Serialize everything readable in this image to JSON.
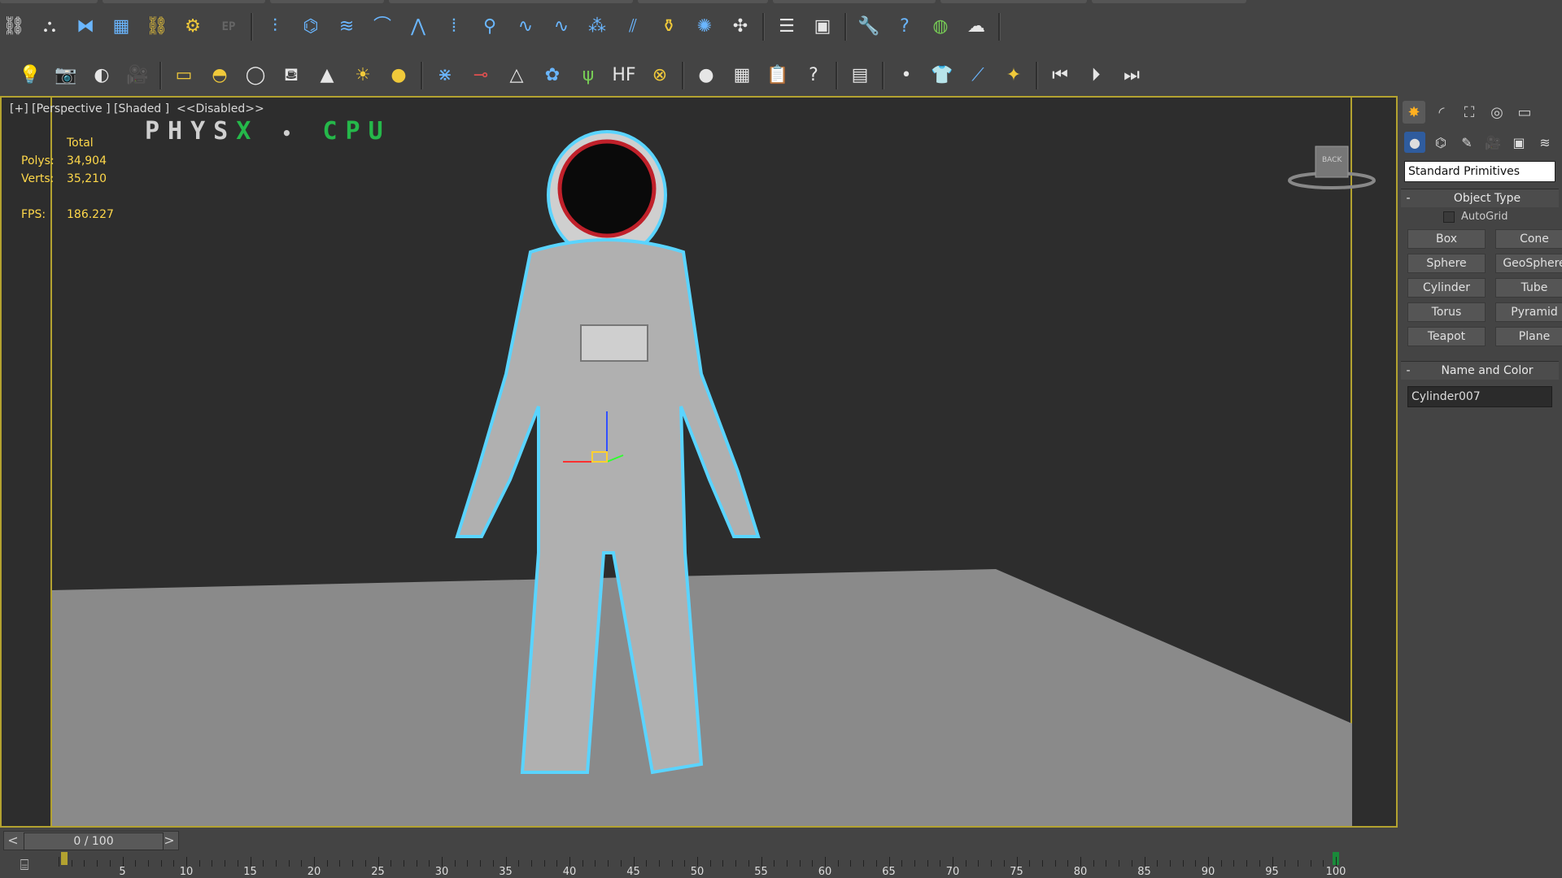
{
  "toolbar_top": {
    "icons": [
      {
        "name": "select-link-icon",
        "glyph": "⛓",
        "c": "w"
      },
      {
        "name": "unlink-icon",
        "glyph": "⛬",
        "c": "w"
      },
      {
        "name": "mirror-icon",
        "glyph": "⧓",
        "c": ""
      },
      {
        "name": "box-mesh-icon",
        "glyph": "▦",
        "c": ""
      },
      {
        "name": "link-tool-icon",
        "glyph": "⛓",
        "c": "y"
      },
      {
        "name": "gear-icon",
        "glyph": "⚙",
        "c": "y"
      },
      {
        "name": "ep-label-icon",
        "glyph": "EP",
        "c": "dim"
      },
      {
        "name": "hair-comb-icon",
        "glyph": "⫶",
        "c": ""
      },
      {
        "name": "hair-twist-icon",
        "glyph": "⌬",
        "c": ""
      },
      {
        "name": "hair-curl-icon",
        "glyph": "≋",
        "c": ""
      },
      {
        "name": "hair-arch-icon",
        "glyph": "⌒",
        "c": ""
      },
      {
        "name": "hair-spike-icon",
        "glyph": "⋀",
        "c": ""
      },
      {
        "name": "hair-strands-icon",
        "glyph": "⦙",
        "c": ""
      },
      {
        "name": "light-pin-icon",
        "glyph": "⚲",
        "c": ""
      },
      {
        "name": "hair-wave-icon",
        "glyph": "∿",
        "c": ""
      },
      {
        "name": "hair-wave2-icon",
        "glyph": "∿",
        "c": ""
      },
      {
        "name": "hair-clump-icon",
        "glyph": "⁂",
        "c": ""
      },
      {
        "name": "hair-brush-icon",
        "glyph": "⫽",
        "c": ""
      },
      {
        "name": "bottle-icon",
        "glyph": "⚱",
        "c": "y"
      },
      {
        "name": "emitter-icon",
        "glyph": "✺",
        "c": ""
      },
      {
        "name": "fan-icon",
        "glyph": "✣",
        "c": "w"
      },
      {
        "name": "script-icon",
        "glyph": "☰",
        "c": "w"
      },
      {
        "name": "render-setup-icon",
        "glyph": "▣",
        "c": "w"
      },
      {
        "name": "wrench-icon",
        "glyph": "🔧",
        "c": "r"
      },
      {
        "name": "help-icon",
        "glyph": "?",
        "c": ""
      },
      {
        "name": "globe-icon",
        "glyph": "◍",
        "c": "g"
      },
      {
        "name": "cloud-icon",
        "glyph": "☁",
        "c": "w"
      }
    ]
  },
  "toolbar_second": {
    "icons": [
      {
        "name": "lights-icon",
        "glyph": "💡",
        "c": "w"
      },
      {
        "name": "camera-icon",
        "glyph": "📷",
        "c": "w"
      },
      {
        "name": "sound-icon",
        "glyph": "◐",
        "c": "w"
      },
      {
        "name": "video-camera-icon",
        "glyph": "🎥",
        "c": "w"
      },
      {
        "name": "plane-object-icon",
        "glyph": "▭",
        "c": "y"
      },
      {
        "name": "dome-icon",
        "glyph": "◓",
        "c": "y"
      },
      {
        "name": "sphere-object-icon",
        "glyph": "◯",
        "c": "w"
      },
      {
        "name": "basket-icon",
        "glyph": "⛾",
        "c": "w"
      },
      {
        "name": "cone-object-icon",
        "glyph": "▲",
        "c": "w"
      },
      {
        "name": "sun-icon",
        "glyph": "☀",
        "c": "y"
      },
      {
        "name": "gold-sphere-icon",
        "glyph": "●",
        "c": "y"
      },
      {
        "name": "lattice-icon",
        "glyph": "⋇",
        "c": ""
      },
      {
        "name": "bones-icon",
        "glyph": "⊸",
        "c": "r"
      },
      {
        "name": "pyramid-wire-icon",
        "glyph": "△",
        "c": "w"
      },
      {
        "name": "geo-blob-icon",
        "glyph": "✿",
        "c": ""
      },
      {
        "name": "grass-icon",
        "glyph": "ψ",
        "c": "g"
      },
      {
        "name": "hf-icon",
        "glyph": "HF",
        "c": "w"
      },
      {
        "name": "ox-icon",
        "glyph": "⊗",
        "c": "y"
      },
      {
        "name": "shaded-sphere-icon",
        "glyph": "●",
        "c": "w"
      },
      {
        "name": "material-grid-icon",
        "glyph": "▦",
        "c": "w"
      },
      {
        "name": "clipboard-icon",
        "glyph": "📋",
        "c": "w"
      },
      {
        "name": "question-icon",
        "glyph": "?",
        "c": "w"
      },
      {
        "name": "render-frame-icon",
        "glyph": "▤",
        "c": "w"
      },
      {
        "name": "small-sphere-icon",
        "glyph": "•",
        "c": "w"
      },
      {
        "name": "tshirt-icon",
        "glyph": "👕",
        "c": "w"
      },
      {
        "name": "tube-tool-icon",
        "glyph": "⟋",
        "c": ""
      },
      {
        "name": "magic-wand-icon",
        "glyph": "✦",
        "c": "y"
      },
      {
        "name": "play-back-icon",
        "glyph": "⏮",
        "c": "w"
      },
      {
        "name": "play-icon",
        "glyph": "⏵",
        "c": "w"
      },
      {
        "name": "play-forward-icon",
        "glyph": "⏭",
        "c": "w"
      }
    ]
  },
  "viewport": {
    "label": "[+] [Perspective ] [Shaded ]  <<Disabled>>",
    "physx_left": "PHYS",
    "physx_x": "X",
    "physx_dot": "•",
    "physx_right": "CPU",
    "stats": {
      "header": "Total",
      "polys_label": "Polys:",
      "polys_value": "34,904",
      "verts_label": "Verts:",
      "verts_value": "35,210",
      "fps_label": "FPS:",
      "fps_value": "186.227"
    },
    "viewcube_label": "BACK",
    "colors": {
      "frame": "#b3a230",
      "background": "#2d2d2d",
      "ground": "#8a8a8a",
      "outline": "#5ad4ff"
    }
  },
  "command_panel": {
    "tabs": [
      {
        "name": "create-tab-icon",
        "glyph": "✸",
        "active": true
      },
      {
        "name": "modify-tab-icon",
        "glyph": "◜",
        "active": false
      },
      {
        "name": "hierarchy-tab-icon",
        "glyph": "⛶",
        "active": false
      },
      {
        "name": "motion-tab-icon",
        "glyph": "◎",
        "active": false
      },
      {
        "name": "display-tab-icon",
        "glyph": "▭",
        "active": false
      }
    ],
    "sub_tabs": [
      {
        "name": "geometry-subtab-icon",
        "glyph": "●",
        "active": true
      },
      {
        "name": "shapes-subtab-icon",
        "glyph": "⌬",
        "active": false
      },
      {
        "name": "lights-subtab-icon",
        "glyph": "✎",
        "active": false
      },
      {
        "name": "cameras-subtab-icon",
        "glyph": "🎥",
        "active": false
      },
      {
        "name": "helpers-subtab-icon",
        "glyph": "▣",
        "active": false
      },
      {
        "name": "spacewarps-subtab-icon",
        "glyph": "≋",
        "active": false
      }
    ],
    "dropdown_value": "Standard Primitives",
    "object_type": {
      "minus": "-",
      "title": "Object Type",
      "autogrid": "AutoGrid",
      "buttons": [
        "Box",
        "Cone",
        "Sphere",
        "GeoSphere",
        "Cylinder",
        "Tube",
        "Torus",
        "Pyramid",
        "Teapot",
        "Plane"
      ]
    },
    "name_and_color": {
      "minus": "-",
      "title": "Name and Color",
      "name_value": "Cylinder007"
    }
  },
  "timeline": {
    "prev": "<",
    "next": ">",
    "frame_display": "0 / 100",
    "labels": [
      "5",
      "10",
      "15",
      "20",
      "25",
      "30",
      "35",
      "40",
      "45",
      "50",
      "55",
      "60",
      "65",
      "70",
      "75",
      "80",
      "85",
      "90",
      "95",
      "100"
    ]
  }
}
